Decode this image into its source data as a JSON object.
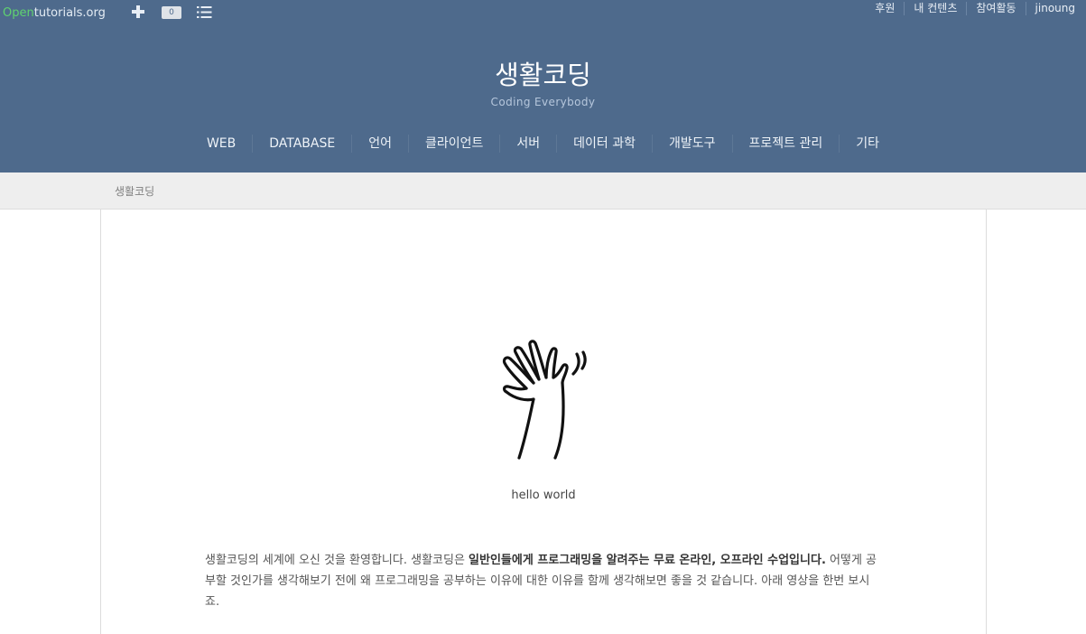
{
  "topbar": {
    "logo_open": "Open",
    "logo_rest": "tutorials.org",
    "notification_count": "0",
    "right_links": [
      "후원",
      "내 컨텐츠",
      "참여활동",
      "jinoung"
    ]
  },
  "site": {
    "title": "생활코딩",
    "subtitle": "Coding Everybody"
  },
  "nav": [
    "WEB",
    "DATABASE",
    "언어",
    "클라이언트",
    "서버",
    "데이터 과학",
    "개발도구",
    "프로젝트 관리",
    "기타"
  ],
  "breadcrumb": "생활코딩",
  "content": {
    "image_caption": "hello world",
    "intro_part1": "생활코딩의 세계에 오신 것을 환영합니다. 생활코딩은 ",
    "intro_bold": "일반인들에게 프로그래밍을 알려주는 무료 온라인, 오프라인 수업입니다.",
    "intro_part2": " 어떻게 공부할 것인가를 생각해보기 전에 왜 프로그래밍을 공부하는 이유에 대한 이유를 함께 생각해보면 좋을 것 같습니다. 아래 영상을 한번 보시죠."
  },
  "colors": {
    "header_bg": "#4e6a8c",
    "logo_accent": "#5fd36f",
    "breadcrumb_bg": "#eeeeee"
  },
  "icons": [
    "plus-icon",
    "list-icon",
    "waving-hand-icon"
  ]
}
